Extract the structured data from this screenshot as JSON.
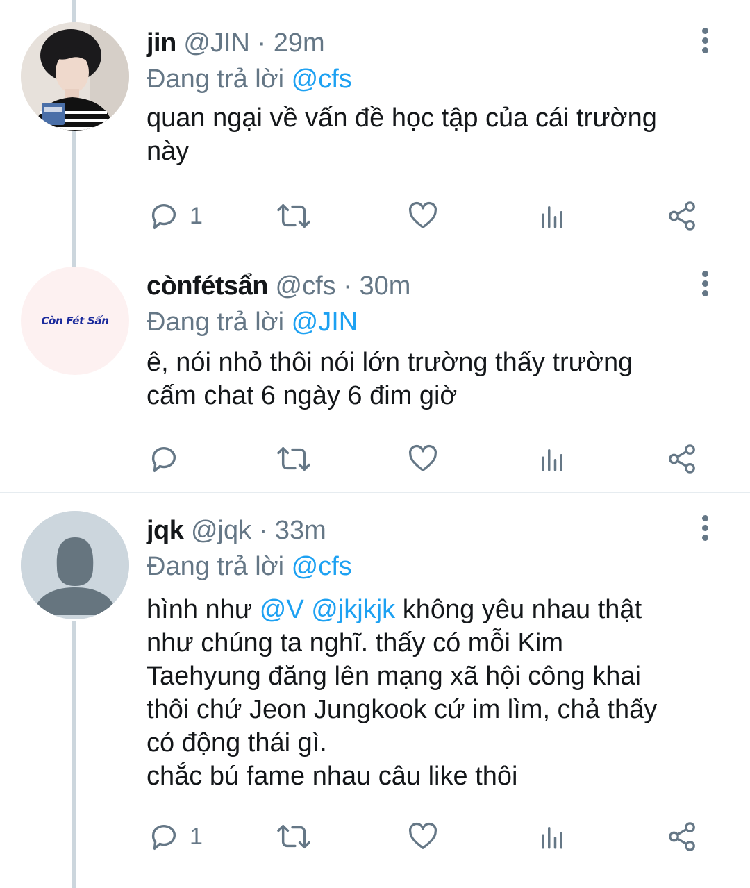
{
  "reply_prefix": "Đang trả lời",
  "tweets": [
    {
      "name": "jin",
      "handle": "@JIN",
      "sep": "·",
      "time": "29m",
      "reply_to": "@cfs",
      "lines": [
        "quan ngại về vấn đề học tập của cái trường",
        "này"
      ],
      "reply_count": "1",
      "avatar_icon": "photo-avatar"
    },
    {
      "name": "cònfétsẩn",
      "handle": "@cfs",
      "sep": "·",
      "time": "30m",
      "reply_to": "@JIN",
      "lines": [
        "ê, nói nhỏ thôi nói lớn trường thấy trường",
        "cấm chat 6 ngày 6 đim giờ"
      ],
      "reply_count": "",
      "avatar_text": "Còn Fét Sẩn"
    },
    {
      "name": "jqk",
      "handle": "@jqk",
      "sep": "·",
      "time": "33m",
      "reply_to": "@cfs",
      "first_line": {
        "pre": "hình như ",
        "mention1": "@V",
        "mid": " ",
        "mention2": "@jkjkjk",
        "post": " không yêu nhau thật"
      },
      "lines": [
        "như chúng ta nghĩ. thấy có mỗi Kim",
        "Taehyung đăng lên mạng xã hội công khai",
        "thôi chứ Jeon Jungkook cứ im lìm, chả thấy",
        "có động thái gì.",
        "chắc bú fame nhau câu like thôi"
      ],
      "reply_count": "1",
      "avatar_icon": "default-person-avatar"
    }
  ],
  "colors": {
    "link": "#1da1f2",
    "muted": "#657786",
    "text": "#14171a",
    "thread_line": "#ccd6dd"
  }
}
